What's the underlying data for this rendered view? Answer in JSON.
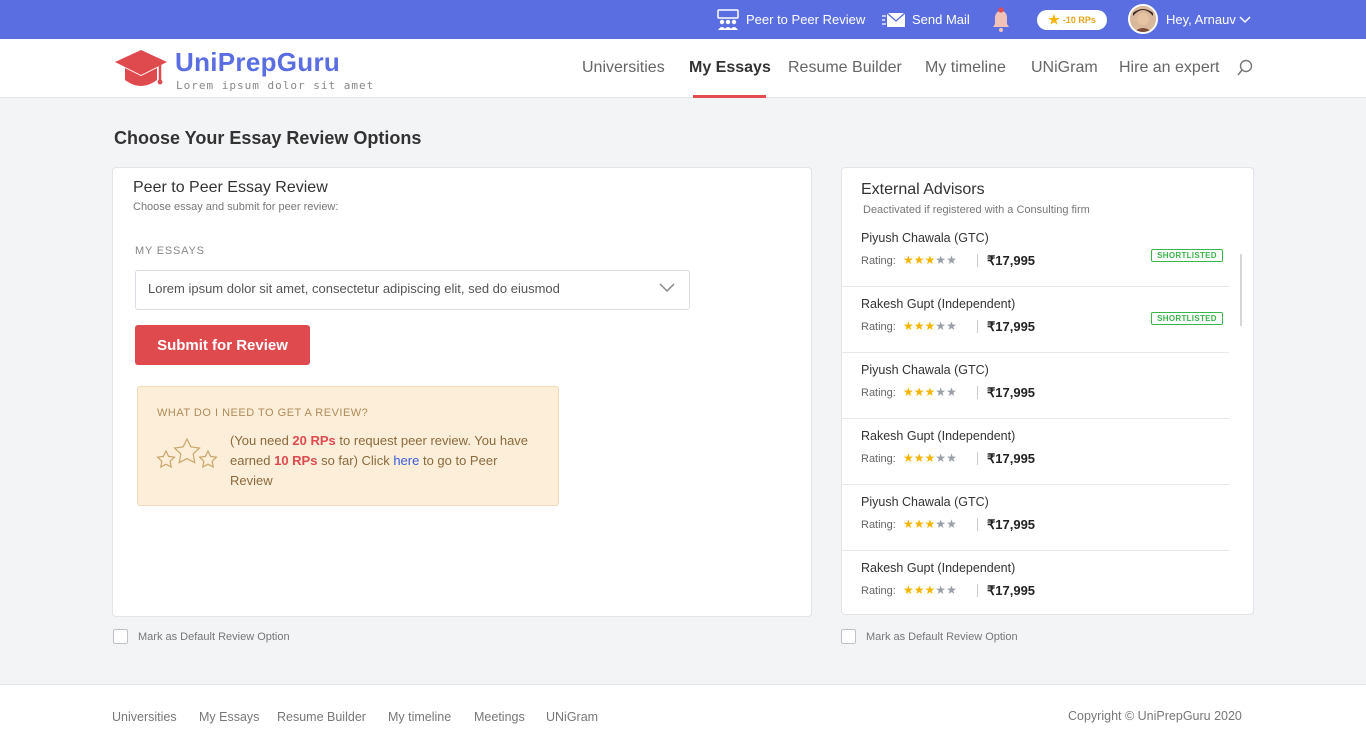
{
  "topbar": {
    "peer_review": "Peer to Peer Review",
    "send_mail": "Send Mail",
    "rp_badge": "-10 RPs",
    "greeting": "Hey, Arnauv"
  },
  "brand": {
    "name": "UniPrepGuru",
    "tagline": "Lorem ipsum dolor sit amet",
    "accent": "#5b6ee1",
    "logo_red": "#df4a4f"
  },
  "nav": {
    "universities": "Universities",
    "my_essays": "My Essays",
    "resume_builder": "Resume Builder",
    "my_timeline": "My timeline",
    "unigram": "UNiGram",
    "hire_expert": "Hire an expert"
  },
  "page_title": "Choose Your Essay Review Options",
  "peer": {
    "title": "Peer to Peer Essay Review",
    "subtitle": "Choose essay and submit for peer review:",
    "field_label": "MY ESSAYS",
    "selected_essay": "Lorem ipsum dolor sit amet, consectetur adipiscing elit, sed do eiusmod",
    "submit_label": "Submit for Review",
    "info_title": "WHAT DO I NEED TO GET A REVIEW?",
    "info_t1": "(You need ",
    "info_rp_needed": "20 RPs",
    "info_t2": " to request peer review. You have earned ",
    "info_rp_earned": "10 RPs",
    "info_t3": " so far) Click ",
    "info_link": "here",
    "info_t4": " to go to Peer Review",
    "default_label": "Mark as Default Review Option"
  },
  "external": {
    "title": "External Advisors",
    "subtitle": "Deactivated if registered with a Consulting firm",
    "rating_label": "Rating:",
    "badge_label": "SHORTLISTED",
    "advisors": [
      {
        "name": "Piyush Chawala (GTC)",
        "rating": 3,
        "price": "₹17,995",
        "shortlisted": true
      },
      {
        "name": "Rakesh Gupt (Independent)",
        "rating": 3,
        "price": "₹17,995",
        "shortlisted": true
      },
      {
        "name": "Piyush Chawala (GTC)",
        "rating": 3,
        "price": "₹17,995",
        "shortlisted": false
      },
      {
        "name": "Rakesh Gupt (Independent)",
        "rating": 3,
        "price": "₹17,995",
        "shortlisted": false
      },
      {
        "name": "Piyush Chawala (GTC)",
        "rating": 3,
        "price": "₹17,995",
        "shortlisted": false
      },
      {
        "name": "Rakesh Gupt (Independent)",
        "rating": 3,
        "price": "₹17,995",
        "shortlisted": false
      }
    ],
    "default_label": "Mark as Default Review Option"
  },
  "footer": {
    "links": [
      "Universities",
      "My Essays",
      "Resume Builder",
      "My timeline",
      "Meetings",
      "UNiGram"
    ],
    "copyright": "Copyright © UniPrepGuru 2020"
  }
}
